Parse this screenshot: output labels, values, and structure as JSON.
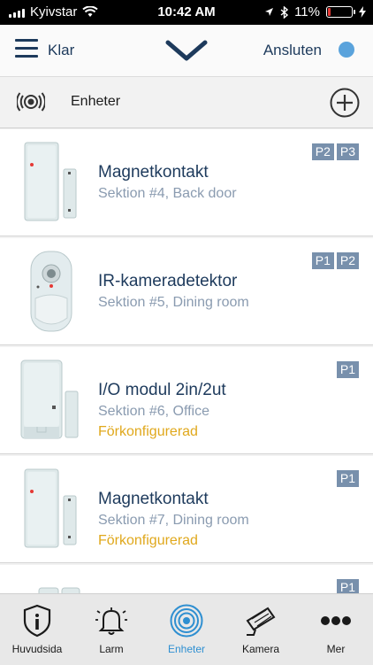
{
  "statusbar": {
    "carrier": "Kyivstar",
    "time": "10:42 AM",
    "battery": "11%"
  },
  "header": {
    "menu_label": "Klar",
    "connection_label": "Ansluten",
    "connection_color": "#5aa3dc"
  },
  "section": {
    "title": "Enheter"
  },
  "devices": [
    {
      "name": "Magnetkontakt",
      "subtitle": "Sektion #4, Back door",
      "status": "",
      "badges": [
        "P2",
        "P3"
      ],
      "icon": "magnetic-contact"
    },
    {
      "name": "IR-kameradetektor",
      "subtitle": "Sektion #5, Dining room",
      "status": "",
      "badges": [
        "P1",
        "P2"
      ],
      "icon": "ir-camera-detector"
    },
    {
      "name": "I/O modul 2in/2ut",
      "subtitle": "Sektion #6, Office",
      "status": "Förkonfigurerad",
      "badges": [
        "P1"
      ],
      "icon": "io-module"
    },
    {
      "name": "Magnetkontakt",
      "subtitle": "Sektion #7, Dining room",
      "status": "Förkonfigurerad",
      "badges": [
        "P1"
      ],
      "icon": "magnetic-contact"
    },
    {
      "name": "",
      "subtitle": "",
      "status": "",
      "badges": [
        "P1"
      ],
      "icon": "magnetic-contact"
    }
  ],
  "tabs": [
    {
      "label": "Huvudsida",
      "icon": "shield-icon"
    },
    {
      "label": "Larm",
      "icon": "bell-icon"
    },
    {
      "label": "Enheter",
      "icon": "devices-icon",
      "active": true
    },
    {
      "label": "Kamera",
      "icon": "camera-icon"
    },
    {
      "label": "Mer",
      "icon": "more-icon"
    }
  ],
  "colors": {
    "accent": "#2e8fd1",
    "navy": "#1d3a5c",
    "badge": "#7890ac",
    "warning": "#e0a81c"
  }
}
